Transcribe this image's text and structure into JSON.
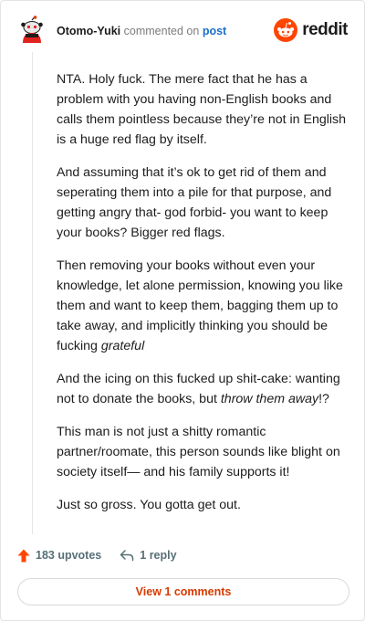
{
  "header": {
    "username": "Otomo-Yuki",
    "action_text": "commented on",
    "post_link": "post",
    "brand": "reddit"
  },
  "comment": {
    "p1": "NTA. Holy fuck. The mere fact that he has a problem with you having non-English books and calls them pointless because they’re not in English is a huge red flag by itself.",
    "p2": "And assuming that it’s ok to get rid of them and seperating them into a pile for that purpose, and getting angry that- god forbid- you want to keep your books? Bigger red flags.",
    "p3_main": "Then removing your books without even your knowledge, let alone permission, knowing you like them and want to keep them, bagging them up to take away, and implicitly thinking you should be fucking ",
    "p3_em": "grateful",
    "p4_main": "And the icing on this fucked up shit-cake: wanting not to donate the books, but ",
    "p4_em": "throw them away",
    "p4_end": "!?",
    "p5": "This man is not just a shitty romantic partner/roomate, this person sounds like blight on society itself— and his family supports it!",
    "p6": "Just so gross. You gotta get out."
  },
  "actions": {
    "upvotes": "183 upvotes",
    "replies": "1 reply"
  },
  "footer": {
    "view_comments": "View 1 comments"
  },
  "colors": {
    "brand_orange": "#ff4500",
    "link_blue": "#1a6fc9",
    "button_text": "#d93a00"
  },
  "icons": {
    "avatar": "snoo-avatar-icon",
    "brand": "reddit-logo-icon",
    "upvote": "upvote-arrow-icon",
    "reply": "reply-arrow-icon"
  }
}
